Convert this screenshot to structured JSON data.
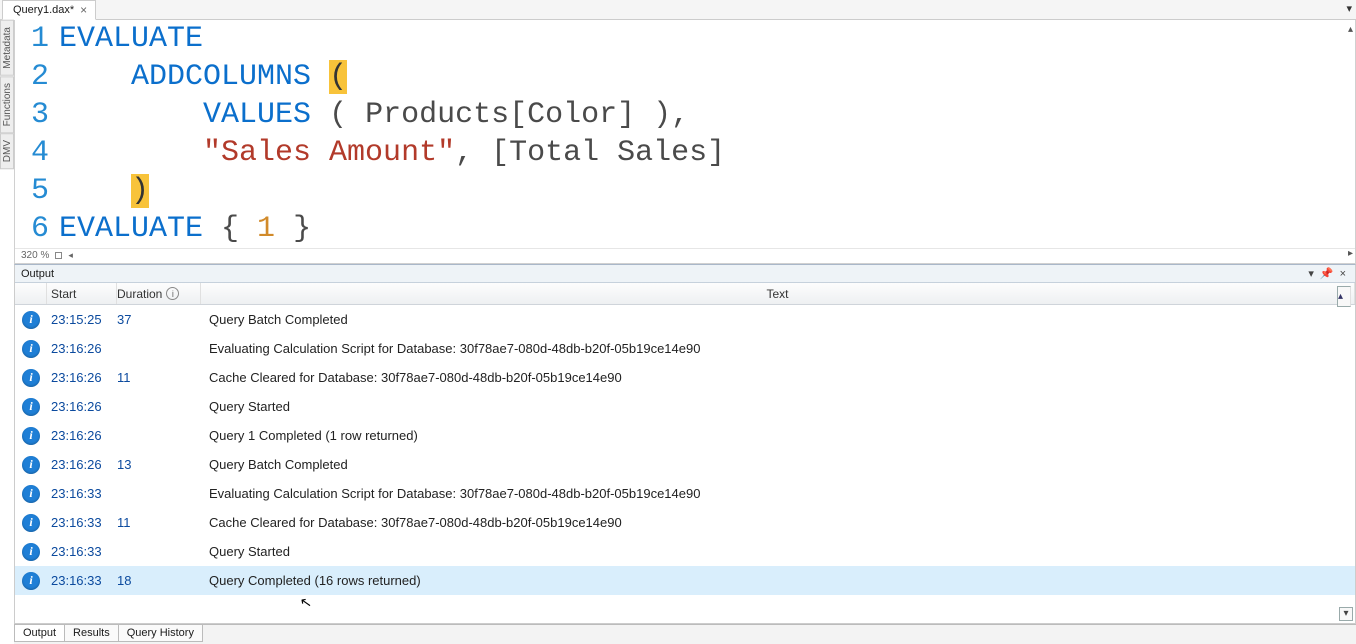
{
  "file_tab": {
    "label": "Query1.dax*"
  },
  "side_tabs": [
    "Metadata",
    "Functions",
    "DMV"
  ],
  "editor": {
    "zoom": "320 %",
    "lines": [
      {
        "n": 1,
        "tokens": [
          {
            "t": "EVALUATE",
            "c": "tk-kw"
          }
        ]
      },
      {
        "n": 2,
        "tokens": [
          {
            "t": "    ",
            "c": ""
          },
          {
            "t": "ADDCOLUMNS",
            "c": "tk-kw"
          },
          {
            "t": " ",
            "c": ""
          },
          {
            "t": "(",
            "c": "tk-paren-hl"
          }
        ]
      },
      {
        "n": 3,
        "tokens": [
          {
            "t": "        ",
            "c": ""
          },
          {
            "t": "VALUES",
            "c": "tk-kw"
          },
          {
            "t": " ( Products[Color] ),",
            "c": "tk-punct"
          }
        ]
      },
      {
        "n": 4,
        "tokens": [
          {
            "t": "        ",
            "c": ""
          },
          {
            "t": "\"Sales Amount\"",
            "c": "tk-str"
          },
          {
            "t": ", [Total Sales]",
            "c": "tk-punct"
          }
        ]
      },
      {
        "n": 5,
        "tokens": [
          {
            "t": "    ",
            "c": ""
          },
          {
            "t": ")",
            "c": "tk-paren-hl"
          }
        ]
      },
      {
        "n": 6,
        "tokens": [
          {
            "t": "EVALUATE",
            "c": "tk-kw"
          },
          {
            "t": " { ",
            "c": "tk-punct"
          },
          {
            "t": "1",
            "c": "tk-num"
          },
          {
            "t": " }",
            "c": "tk-punct"
          }
        ]
      }
    ]
  },
  "output": {
    "title": "Output",
    "headers": {
      "start": "Start",
      "duration": "Duration",
      "text": "Text"
    },
    "rows": [
      {
        "start": "23:15:25",
        "dur": "37",
        "text": "Query Batch Completed"
      },
      {
        "start": "23:16:26",
        "dur": "",
        "text": "Evaluating Calculation Script for Database: 30f78ae7-080d-48db-b20f-05b19ce14e90"
      },
      {
        "start": "23:16:26",
        "dur": "11",
        "text": "Cache Cleared for Database: 30f78ae7-080d-48db-b20f-05b19ce14e90"
      },
      {
        "start": "23:16:26",
        "dur": "",
        "text": "Query Started"
      },
      {
        "start": "23:16:26",
        "dur": "",
        "text": "Query 1 Completed (1 row returned)"
      },
      {
        "start": "23:16:26",
        "dur": "13",
        "text": "Query Batch Completed"
      },
      {
        "start": "23:16:33",
        "dur": "",
        "text": "Evaluating Calculation Script for Database: 30f78ae7-080d-48db-b20f-05b19ce14e90"
      },
      {
        "start": "23:16:33",
        "dur": "11",
        "text": "Cache Cleared for Database: 30f78ae7-080d-48db-b20f-05b19ce14e90"
      },
      {
        "start": "23:16:33",
        "dur": "",
        "text": "Query Started"
      },
      {
        "start": "23:16:33",
        "dur": "18",
        "text": "Query Completed (16 rows returned)",
        "selected": true
      }
    ]
  },
  "bottom_tabs": [
    "Output",
    "Results",
    "Query History"
  ],
  "bottom_active": 0
}
